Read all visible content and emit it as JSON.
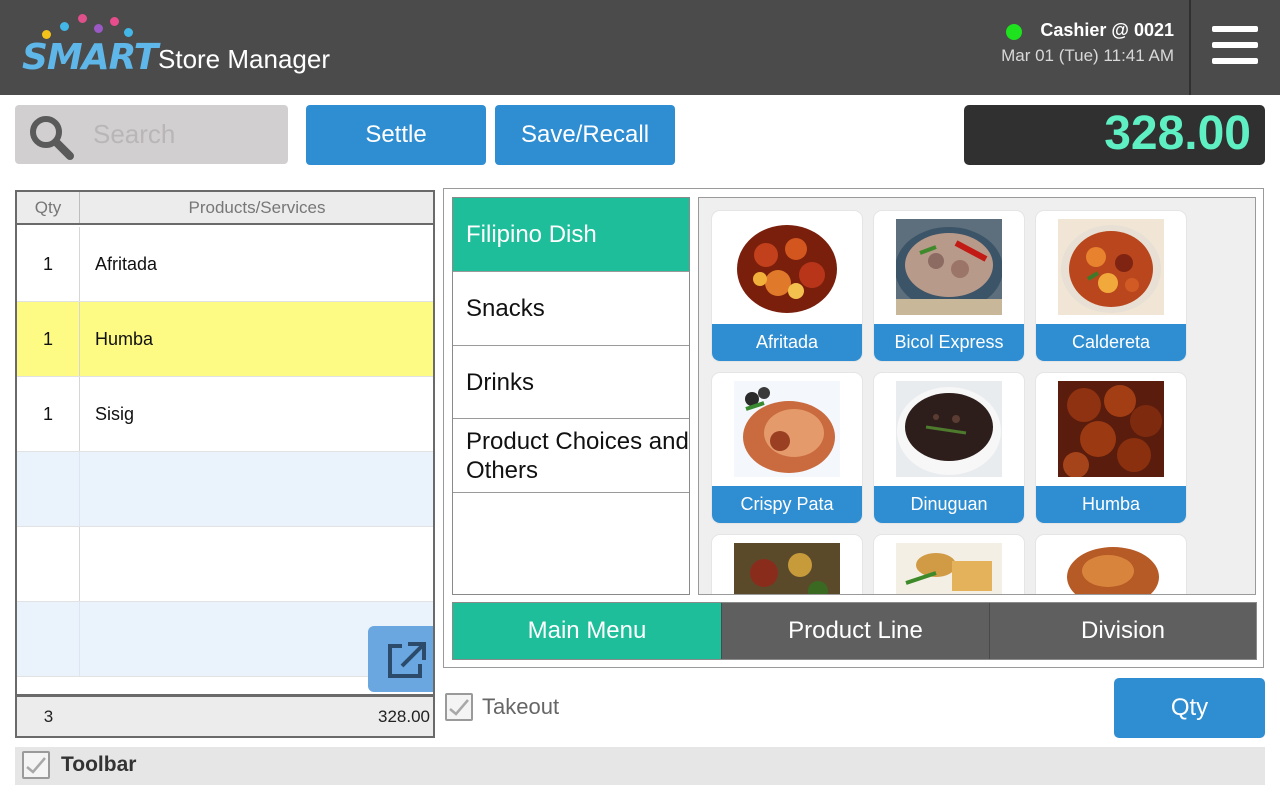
{
  "app": {
    "logo_brand": "SMART",
    "logo_suffix": "Store Manager",
    "cashier": "Cashier @ 0021",
    "datetime": "Mar 01 (Tue) 11:41 AM",
    "status_color": "#1ee21e"
  },
  "toolbar_top": {
    "search_placeholder": "Search",
    "settle_label": "Settle",
    "save_recall_label": "Save/Recall",
    "total": "328.00"
  },
  "order": {
    "col_qty": "Qty",
    "col_product": "Products/Services",
    "items": [
      {
        "qty": "1",
        "name": "Afritada"
      },
      {
        "qty": "1",
        "name": "Humba"
      },
      {
        "qty": "1",
        "name": "Sisig"
      }
    ],
    "total_qty": "3",
    "total_amount": "328.00"
  },
  "categories": [
    {
      "label": "Filipino Dish"
    },
    {
      "label": "Snacks"
    },
    {
      "label": "Drinks"
    },
    {
      "label": "Product Choices and Others"
    }
  ],
  "products": [
    {
      "label": "Afritada",
      "icon": "afritada-food-image"
    },
    {
      "label": "Bicol Express",
      "icon": "bicol-express-food-image"
    },
    {
      "label": "Caldereta",
      "icon": "caldereta-food-image"
    },
    {
      "label": "Crispy Pata",
      "icon": "crispy-pata-food-image"
    },
    {
      "label": "Dinuguan",
      "icon": "dinuguan-food-image"
    },
    {
      "label": "Humba",
      "icon": "humba-food-image"
    }
  ],
  "tabs": [
    {
      "label": "Main Menu"
    },
    {
      "label": "Product Line"
    },
    {
      "label": "Division"
    }
  ],
  "bottom": {
    "takeout_label": "Takeout",
    "qty_label": "Qty",
    "toolbar_label": "Toolbar"
  },
  "colors": {
    "accent_green": "#1ebe9b",
    "button_blue": "#2f8ed2",
    "total_text": "#5ef0c3",
    "selected_row": "#fdfb84"
  }
}
